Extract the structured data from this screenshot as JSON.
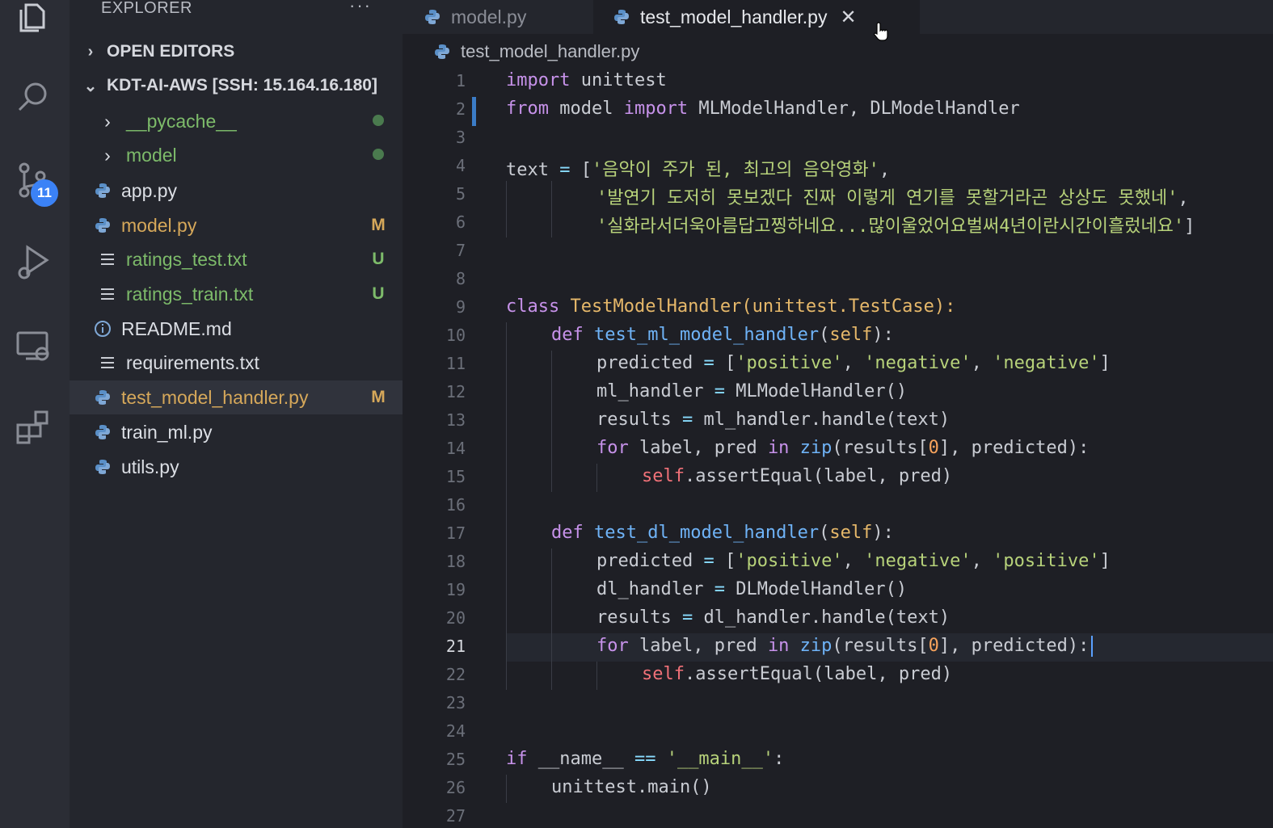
{
  "activity_bar": {
    "icons": [
      "explorer-icon",
      "search-icon",
      "source-control-icon",
      "run-debug-icon",
      "remote-explorer-icon",
      "extensions-icon"
    ],
    "source_control_badge": "11"
  },
  "sidebar": {
    "header": "EXPLORER",
    "more": "···",
    "open_editors": "OPEN EDITORS",
    "workspace": "KDT-AI-AWS [SSH: 15.164.16.180]",
    "items": [
      {
        "label": "__pycache__",
        "status": "",
        "kind": "folder"
      },
      {
        "label": "model",
        "status": "",
        "kind": "folder"
      },
      {
        "label": "app.py",
        "status": "",
        "kind": "python"
      },
      {
        "label": "model.py",
        "status": "M",
        "kind": "python"
      },
      {
        "label": "ratings_test.txt",
        "status": "U",
        "kind": "text"
      },
      {
        "label": "ratings_train.txt",
        "status": "U",
        "kind": "text"
      },
      {
        "label": "README.md",
        "status": "",
        "kind": "info"
      },
      {
        "label": "requirements.txt",
        "status": "",
        "kind": "text"
      },
      {
        "label": "test_model_handler.py",
        "status": "M",
        "kind": "python"
      },
      {
        "label": "train_ml.py",
        "status": "",
        "kind": "python"
      },
      {
        "label": "utils.py",
        "status": "",
        "kind": "python"
      }
    ]
  },
  "tabs": [
    {
      "label": "model.py"
    },
    {
      "label": "test_model_handler.py",
      "close": "✕"
    }
  ],
  "breadcrumb": "test_model_handler.py",
  "editor": {
    "line_numbers": [
      "1",
      "2",
      "3",
      "4",
      "5",
      "6",
      "7",
      "8",
      "9",
      "10",
      "11",
      "12",
      "13",
      "14",
      "15",
      "16",
      "17",
      "18",
      "19",
      "20",
      "21",
      "22",
      "23",
      "24",
      "25",
      "26",
      "27"
    ],
    "current_line": "21",
    "code": {
      "l1_kw": "import",
      "l1_rest": " unittest",
      "l2_kw1": "from",
      "l2_mid": " model ",
      "l2_kw2": "import",
      "l2_rest": " MLModelHandler, DLModelHandler",
      "l4_var": "text",
      "l4_op": " = ",
      "l4_br": "[",
      "l4_str": "'음악이 주가 된, 최고의 음악영화'",
      "l4_end": ",",
      "l5_str": "'발연기 도저히 못보겠다 진짜 이렇게 연기를 못할거라곤 상상도 못했네'",
      "l5_end": ",",
      "l6_str": "'실화라서더욱아름답고찡하네요...많이울었어요벌써4년이란시간이흘렀네요'",
      "l6_end": "]",
      "l9_kw": "class",
      "l9_cls": " TestModelHandler",
      "l9_rest": "(unittest.TestCase):",
      "l10_kw": "def",
      "l10_fn": " test_ml_model_handler",
      "l10_p": "(",
      "l10_self": "self",
      "l10_e": "):",
      "l11_a": "predicted",
      "l11_op": " = ",
      "l11_b": "[",
      "l11_s1": "'positive'",
      "l11_c1": ", ",
      "l11_s2": "'negative'",
      "l11_c2": ", ",
      "l11_s3": "'negative'",
      "l11_e": "]",
      "l12_a": "ml_handler",
      "l12_op": " = ",
      "l12_b": "MLModelHandler()",
      "l13_a": "results",
      "l13_op": " = ",
      "l13_b": "ml_handler.handle(text)",
      "l14_kw": "for",
      "l14_a": " label, pred ",
      "l14_in": "in",
      "l14_fn": " zip",
      "l14_b": "(results[",
      "l14_n": "0",
      "l14_c": "], predicted):",
      "l15_self": "self",
      "l15_rest": ".assertEqual(label, pred)",
      "l17_kw": "def",
      "l17_fn": " test_dl_model_handler",
      "l17_p": "(",
      "l17_self": "self",
      "l17_e": "):",
      "l18_a": "predicted",
      "l18_op": " = ",
      "l18_b": "[",
      "l18_s1": "'positive'",
      "l18_c1": ", ",
      "l18_s2": "'negative'",
      "l18_c2": ", ",
      "l18_s3": "'positive'",
      "l18_e": "]",
      "l19_a": "dl_handler",
      "l19_op": " = ",
      "l19_b": "DLModelHandler()",
      "l20_a": "results",
      "l20_op": " = ",
      "l20_b": "dl_handler.handle(text)",
      "l21_kw": "for",
      "l21_a": " label, pred ",
      "l21_in": "in",
      "l21_fn": " zip",
      "l21_b": "(results[",
      "l21_n": "0",
      "l21_c": "], predicted):",
      "l22_self": "self",
      "l22_rest": ".assertEqual(label, pred)",
      "l25_kw": "if",
      "l25_a": " __name__ ",
      "l25_op": "==",
      "l25_s": " '__main__'",
      "l25_e": ":",
      "l26": "unittest.main()"
    }
  },
  "colors": {
    "accent": "#3b82f6",
    "modified": "#d6a85a",
    "untracked": "#7dbb6a"
  }
}
